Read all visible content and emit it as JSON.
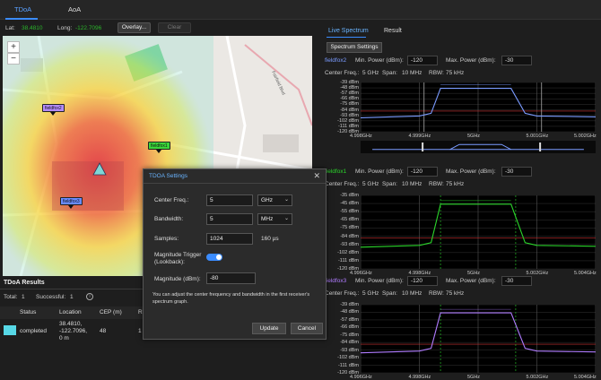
{
  "tabs": {
    "tdoa": "TDoA",
    "aoa": "AoA"
  },
  "toolbar": {
    "lat_label": "Lat:",
    "lat_value": "38.4810",
    "long_label": "Long:",
    "long_value": "-122.7096",
    "overlay_label": "Overlay...",
    "clear_label": "Clear"
  },
  "map": {
    "zoom_in": "+",
    "zoom_out": "−",
    "markers": [
      "fieldfox2",
      "fieldfox1",
      "fieldfox3"
    ],
    "road_label": "Fairfield Blvd"
  },
  "results": {
    "title": "TDoA Results",
    "total_label": "Total:",
    "total_value": "1",
    "successful_label": "Successful:",
    "successful_value": "1",
    "columns": [
      "Status",
      "Location",
      "CEP (m)",
      "R"
    ],
    "row": {
      "status": "completed",
      "location_line1": "38.4810,",
      "location_line2": "-122.7096,",
      "location_line3": "0 m",
      "cep": "48",
      "r": "1"
    },
    "status_color": "#57d8e6"
  },
  "right": {
    "tab_live": "Live Spectrum",
    "tab_result": "Result",
    "spectrum_settings": "Spectrum Settings",
    "min_power_label": "Min. Power (dBm):",
    "max_power_label": "Max. Power (dBm):",
    "center_freq_label": "Center Freq.:",
    "center_freq_value": "5 GHz",
    "span_label": "Span:",
    "span_value": "10 MHz",
    "rbw_label": "RBW:",
    "rbw_value": "75 kHz",
    "panels": [
      {
        "device": "fieldfox2",
        "color": "#7a9bff",
        "min_power": "-120",
        "max_power": "-30",
        "y_ticks": [
          "-39 dBm",
          "-48 dBm",
          "-57 dBm",
          "-66 dBm",
          "-75 dBm",
          "-84 dBm",
          "-93 dBm",
          "-102 dBm",
          "-111 dBm",
          "-120 dBm"
        ],
        "x_ticks": [
          "4.998GHz",
          "4.999GHz",
          "5GHz",
          "5.001GHz",
          "5.002GHz"
        ]
      },
      {
        "device": "fieldfox1",
        "color": "#2bd62b",
        "min_power": "-120",
        "max_power": "-30",
        "y_ticks": [
          "-35 dBm",
          "-45 dBm",
          "-55 dBm",
          "-65 dBm",
          "-75 dBm",
          "-84 dBm",
          "-93 dBm",
          "-102 dBm",
          "-111 dBm",
          "-120 dBm"
        ],
        "x_ticks": [
          "4.996GHz",
          "4.998GHz",
          "5GHz",
          "5.002GHz",
          "5.004GHz"
        ]
      },
      {
        "device": "fieldfox3",
        "color": "#b07cff",
        "min_power": "-120",
        "max_power": "-30",
        "y_ticks": [
          "-39 dBm",
          "-48 dBm",
          "-57 dBm",
          "-66 dBm",
          "-75 dBm",
          "-84 dBm",
          "-93 dBm",
          "-102 dBm",
          "-111 dBm",
          "-120 dBm"
        ],
        "x_ticks": [
          "4.996GHz",
          "4.998GHz",
          "5GHz",
          "5.002GHz",
          "5.004GHz"
        ]
      }
    ]
  },
  "dialog": {
    "title": "TDOA Settings",
    "close": "✕",
    "center_freq_label": "Center Freq.:",
    "center_freq_value": "5",
    "center_freq_unit": "GHz",
    "bandwidth_label": "Bandwidth:",
    "bandwidth_value": "5",
    "bandwidth_unit": "MHz",
    "samples_label": "Samples:",
    "samples_value": "1024",
    "samples_duration": "160 µs",
    "trigger_label_1": "Magnitude Trigger",
    "trigger_label_2": "(Lookback):",
    "trigger_on": true,
    "magnitude_label": "Magnitude (dBm):",
    "magnitude_value": "-80",
    "note": "You can adjust the center frequency and bandwidth in the first receiver's spectrum graph.",
    "update_label": "Update",
    "cancel_label": "Cancel"
  }
}
